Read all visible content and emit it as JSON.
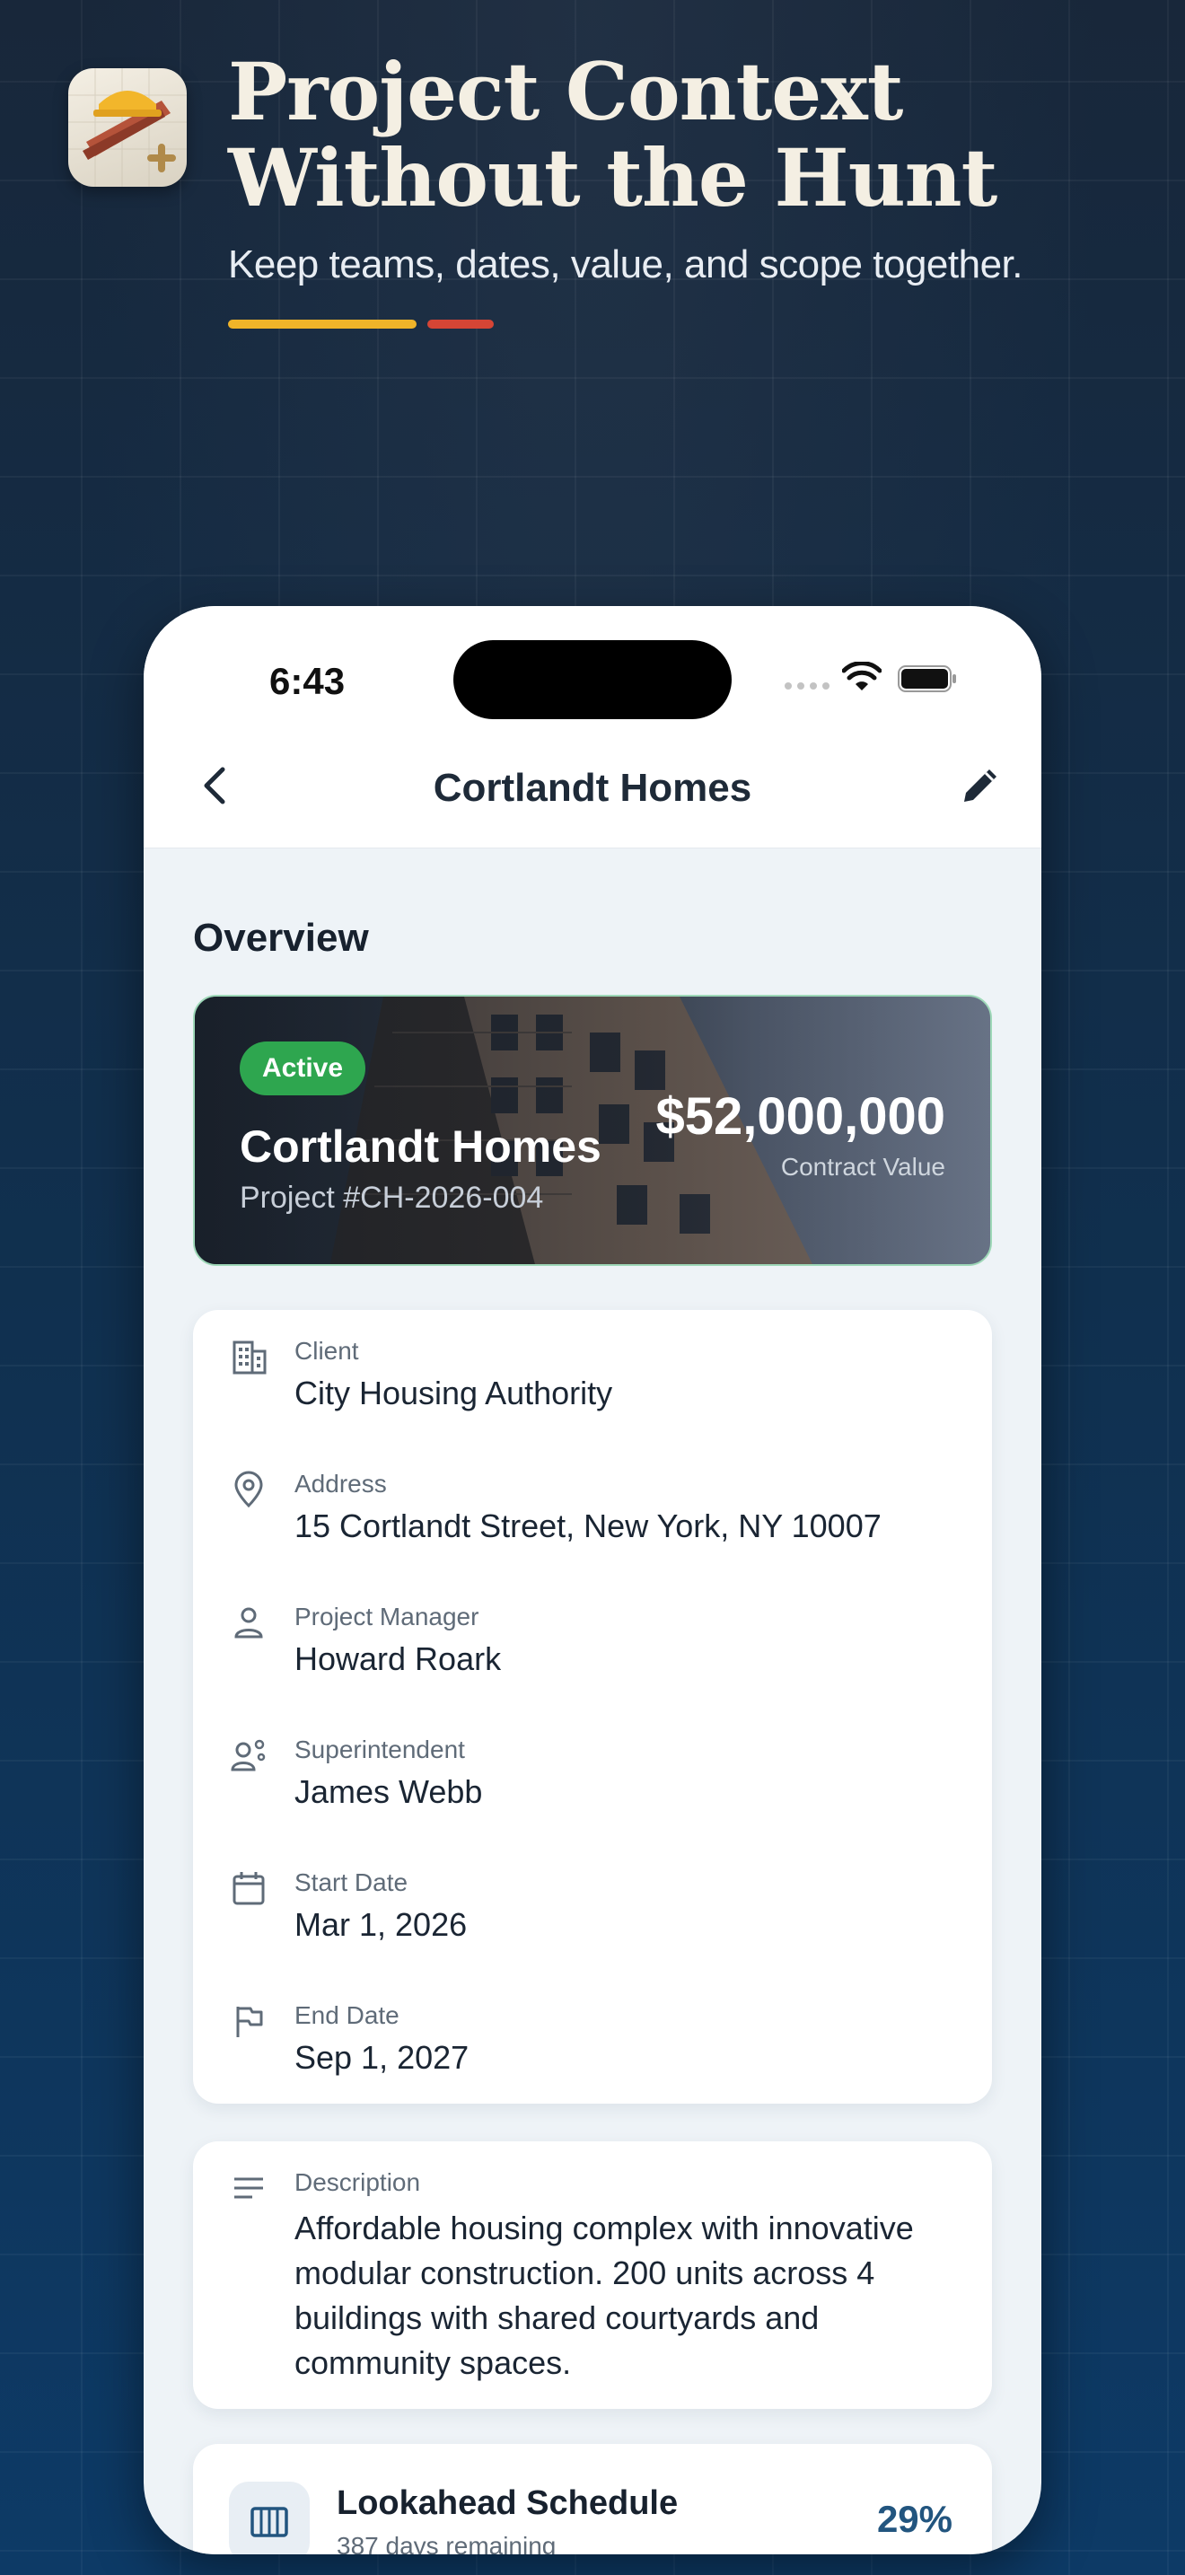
{
  "marketing": {
    "headline_line1": "Project Context",
    "headline_line2": "Without the Hunt",
    "subhead": "Keep teams, dates, value, and scope together.",
    "accent_colors": [
      "#f0b429",
      "#d64535"
    ]
  },
  "status_bar": {
    "time": "6:43"
  },
  "nav": {
    "title": "Cortlandt Homes",
    "back_icon": "chevron-left-icon",
    "edit_icon": "pencil-icon"
  },
  "overview": {
    "section_title": "Overview",
    "status": "Active",
    "status_color": "#2ea64f",
    "project_name": "Cortlandt Homes",
    "project_number": "Project #CH-2026-004",
    "contract_value": "$52,000,000",
    "contract_value_label": "Contract Value"
  },
  "details": [
    {
      "icon": "building-icon",
      "label": "Client",
      "value": "City Housing Authority"
    },
    {
      "icon": "map-pin-icon",
      "label": "Address",
      "value": "15 Cortlandt Street, New York, NY 10007"
    },
    {
      "icon": "person-icon",
      "label": "Project Manager",
      "value": "Howard Roark"
    },
    {
      "icon": "supervisor-icon",
      "label": "Superintendent",
      "value": "James Webb"
    },
    {
      "icon": "calendar-icon",
      "label": "Start Date",
      "value": "Mar 1, 2026"
    },
    {
      "icon": "flag-icon",
      "label": "End Date",
      "value": "Sep 1, 2027"
    }
  ],
  "description": {
    "icon": "text-lines-icon",
    "label": "Description",
    "text": "Affordable housing complex with innovative modular construction. 200 units across 4 buildings with shared courtyards and community spaces."
  },
  "lookahead": {
    "icon": "schedule-columns-icon",
    "title": "Lookahead Schedule",
    "subtitle": "387 days remaining",
    "percent": "29%"
  }
}
